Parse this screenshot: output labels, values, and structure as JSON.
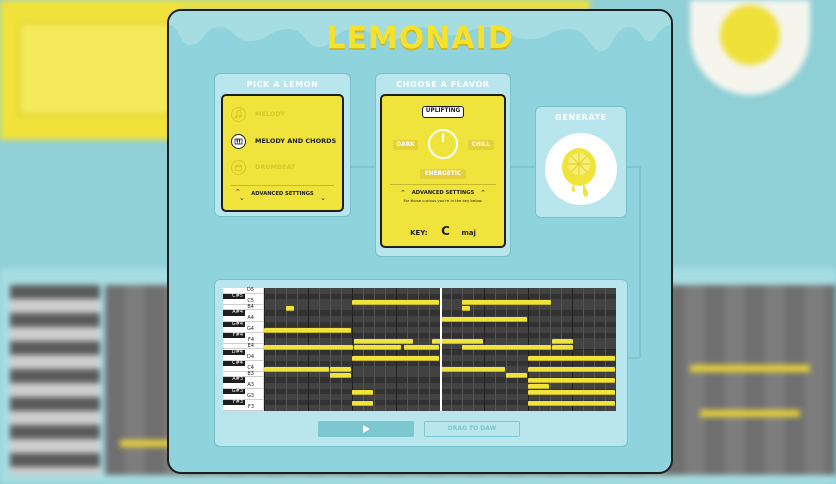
{
  "app": {
    "logo_text": "LEMONAID"
  },
  "pick_lemon": {
    "title": "PICK A LEMON",
    "options": [
      {
        "label": "MELODY",
        "icon": "music-note-icon",
        "selected": false
      },
      {
        "label": "MELODY AND CHORDS",
        "icon": "piano-icon",
        "selected": true
      },
      {
        "label": "DRUMBEAT",
        "icon": "drum-icon",
        "selected": false
      }
    ],
    "advanced_label": "ADVANCED SETTINGS"
  },
  "flavor": {
    "title": "CHOOSE A FLAVOR",
    "moods": {
      "top": "UPLIFTING",
      "left": "DARK",
      "right": "CHILL",
      "bottom": "ENERGETIC"
    },
    "selected_mood": "UPLIFTING",
    "advanced_label": "ADVANCED SETTINGS",
    "advanced_hint": "For those curious you're in the key below.",
    "key_label": "KEY:",
    "key_note": "C",
    "key_mode": "maj"
  },
  "generate": {
    "title": "GENERATE",
    "icon": "lemon-icon"
  },
  "piano_roll": {
    "key_labels": [
      "D5",
      "C#5",
      "C5",
      "B4",
      "A#4",
      "A4",
      "G#4",
      "G4",
      "F#4",
      "F4",
      "E4",
      "D#4",
      "D4",
      "C#4",
      "C4",
      "B3",
      "A#3",
      "A3",
      "G#3",
      "G3",
      "F#3",
      "F3"
    ],
    "play_icon": "play-icon",
    "drag_label": "DRAG TO DAW"
  },
  "colors": {
    "lemon": "#f0e33b",
    "panel": "#b8e6ec",
    "window": "#8fd3dc",
    "outline": "#1e1e1e"
  }
}
